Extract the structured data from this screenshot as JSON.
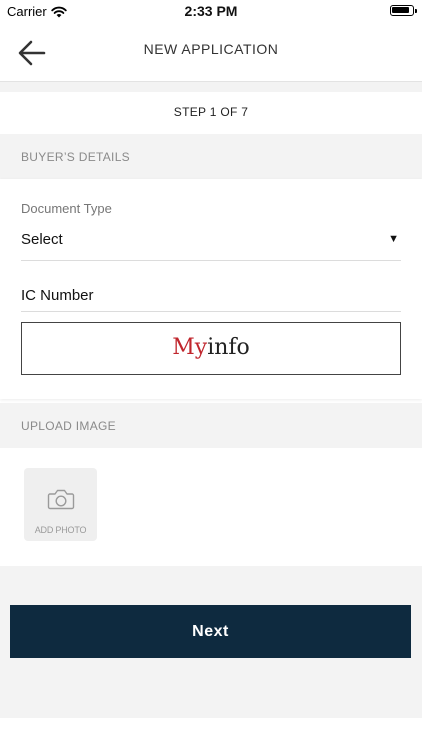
{
  "status_bar": {
    "carrier": "Carrier",
    "time": "2:33 PM",
    "icons": [
      "wifi-icon",
      "battery-icon"
    ]
  },
  "nav": {
    "title": "NEW APPLICATION",
    "back_icon": "arrow-left-icon"
  },
  "step": {
    "text": "STEP 1 OF 7"
  },
  "buyer_section": {
    "header": "BUYER’S DETAILS",
    "document_type": {
      "label": "Document Type",
      "value": "Select",
      "arrow": "▼"
    },
    "ic_number": {
      "placeholder": "IC Number"
    },
    "myinfo": {
      "part1": "My",
      "part2": "info",
      "brand_color": "#c0262d"
    }
  },
  "upload_section": {
    "header": "UPLOAD IMAGE",
    "add_photo_label": "ADD PHOTO",
    "icon": "camera-icon"
  },
  "footer": {
    "next_label": "Next",
    "button_color": "#0e2a3f"
  }
}
